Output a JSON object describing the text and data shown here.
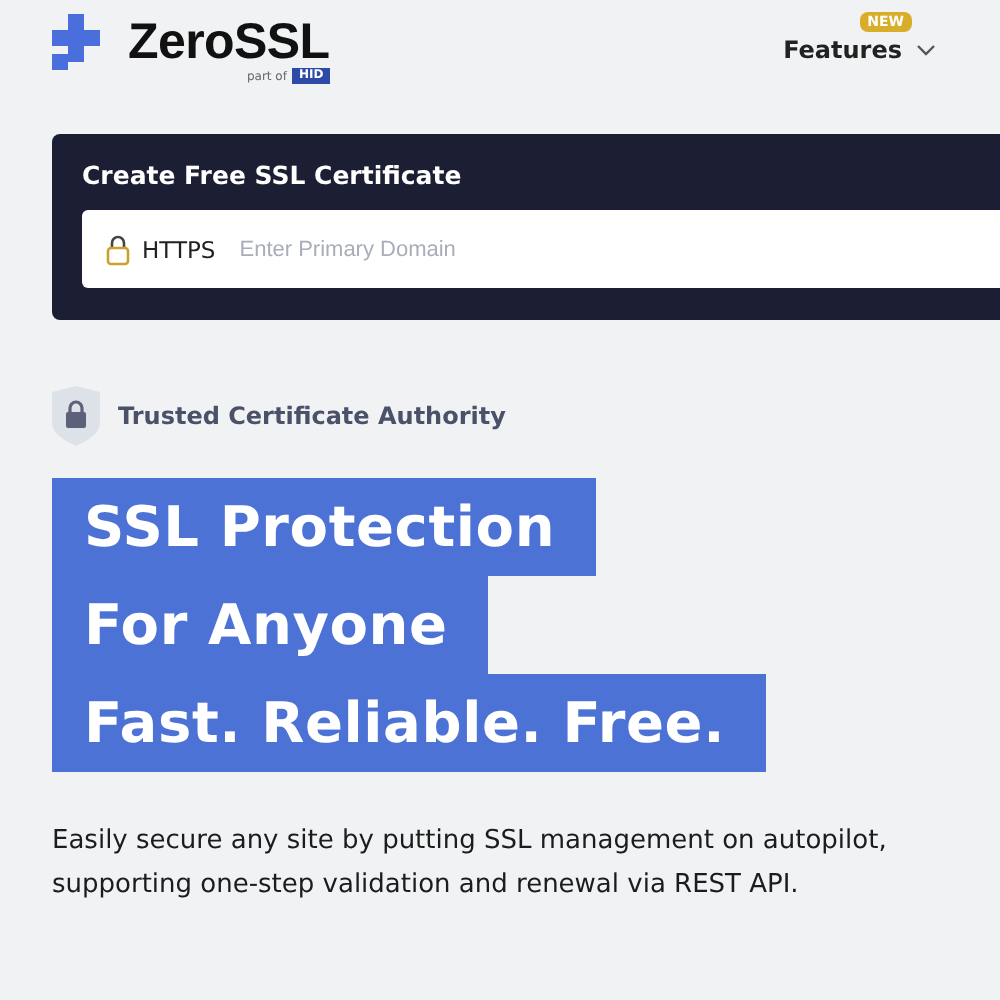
{
  "header": {
    "logo": {
      "name": "ZeroSSL",
      "tagline": "part of",
      "parent_badge": "HID"
    },
    "nav": [
      {
        "label": "Features",
        "badge": "NEW"
      }
    ]
  },
  "certificate_form": {
    "title": "Create Free SSL Certificate",
    "protocol": "HTTPS",
    "placeholder": "Enter Primary Domain"
  },
  "trust_badge": "Trusted Certificate Authority",
  "headline": [
    "SSL Protection",
    "For Anyone",
    "Fast. Reliable. Free."
  ],
  "description": "Easily secure any site by putting SSL management on autopilot, supporting one-step validation and renewal via REST API."
}
